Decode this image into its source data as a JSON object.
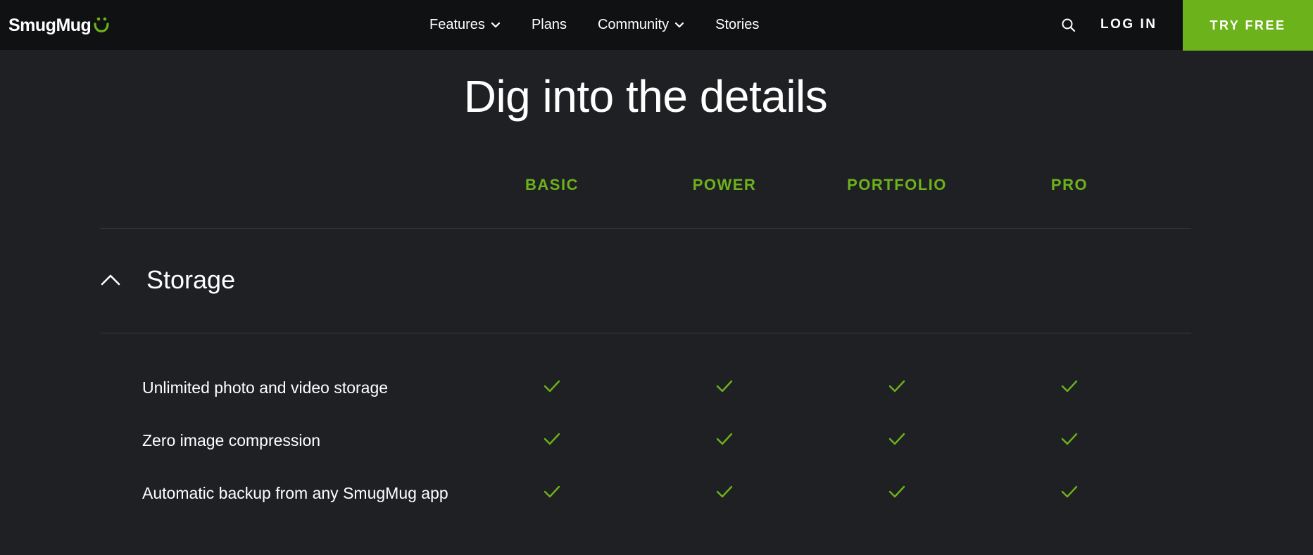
{
  "header": {
    "logo_text": "SmugMug",
    "nav": [
      {
        "label": "Features",
        "has_dropdown": true
      },
      {
        "label": "Plans",
        "has_dropdown": false
      },
      {
        "label": "Community",
        "has_dropdown": true
      },
      {
        "label": "Stories",
        "has_dropdown": false
      }
    ],
    "search_icon": "search-icon",
    "login_label": "LOG IN",
    "try_free_label": "TRY FREE"
  },
  "main": {
    "title": "Dig into the details",
    "plans": [
      "BASIC",
      "POWER",
      "PORTFOLIO",
      "PRO"
    ],
    "section": {
      "title": "Storage",
      "expanded": true,
      "features": [
        {
          "label": "Unlimited photo and video storage",
          "included": [
            true,
            true,
            true,
            true
          ]
        },
        {
          "label": "Zero image compression",
          "included": [
            true,
            true,
            true,
            true
          ]
        },
        {
          "label": "Automatic backup from any SmugMug app",
          "included": [
            true,
            true,
            true,
            true
          ]
        }
      ]
    }
  },
  "colors": {
    "background": "#1f2024",
    "topbar": "#101112",
    "accent_green": "#6cb21b",
    "divider": "#383a40",
    "text": "#ffffff"
  }
}
